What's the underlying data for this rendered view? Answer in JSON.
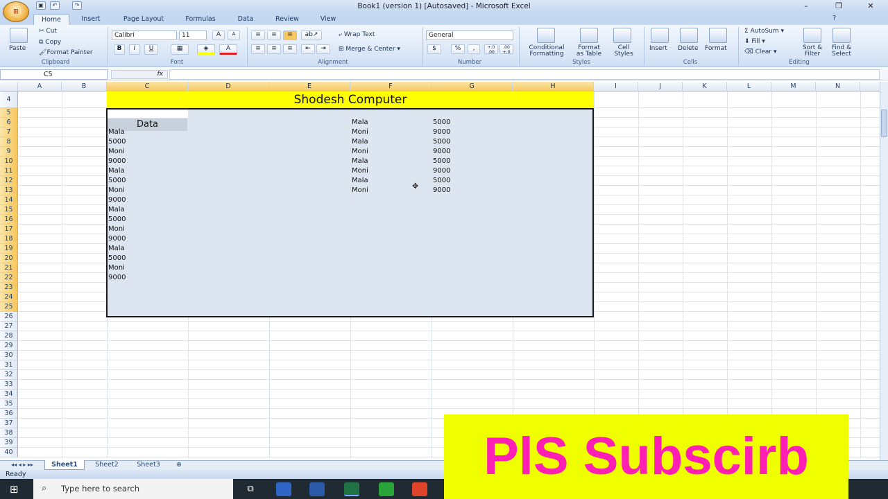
{
  "window": {
    "title": "Book1 (version 1) [Autosaved] - Microsoft Excel"
  },
  "qat": {
    "save_icon": "save-icon",
    "undo_icon": "undo-icon",
    "redo_icon": "redo-icon",
    "office_icon": "office-logo-icon"
  },
  "tabs": [
    {
      "label": "Home"
    },
    {
      "label": "Insert"
    },
    {
      "label": "Page Layout"
    },
    {
      "label": "Formulas"
    },
    {
      "label": "Data"
    },
    {
      "label": "Review"
    },
    {
      "label": "View"
    }
  ],
  "ribbon": {
    "clipboard": {
      "paste": "Paste",
      "cut": "Cut",
      "copy": "Copy",
      "format_painter": "Format Painter",
      "label": "Clipboard"
    },
    "font": {
      "name": "Calibri",
      "size": "11",
      "label": "Font",
      "bold": "B",
      "italic": "I",
      "underline": "U",
      "grow": "A",
      "shrink": "A",
      "font_color": "A"
    },
    "alignment": {
      "wrap": "Wrap Text",
      "merge": "Merge & Center",
      "label": "Alignment"
    },
    "number": {
      "format": "General",
      "currency": "$",
      "percent": "%",
      "comma": ",",
      "inc_dec": "+.0 .00",
      "dec_dec": ".00 +.0",
      "label": "Number"
    },
    "styles": {
      "conditional": [
        "Conditional",
        "Formatting"
      ],
      "format_table": [
        "Format",
        "as Table"
      ],
      "cell_styles": [
        "Cell",
        "Styles"
      ],
      "label": "Styles"
    },
    "cells": {
      "insert": "Insert",
      "delete": "Delete",
      "format": "Format",
      "label": "Cells"
    },
    "editing": {
      "autosum": "AutoSum",
      "fill": "Fill",
      "clear": "Clear",
      "sort": [
        "Sort &",
        "Filter"
      ],
      "find": [
        "Find &",
        "Select"
      ],
      "label": "Editing"
    }
  },
  "formula_bar": {
    "name_box": "C5",
    "fx": "fx",
    "value": ""
  },
  "columns": [
    "A",
    "B",
    "C",
    "D",
    "E",
    "F",
    "G",
    "H",
    "I",
    "J",
    "K",
    "L",
    "M",
    "N"
  ],
  "rows": [
    "4",
    "5",
    "6",
    "7",
    "8",
    "9",
    "10",
    "11",
    "12",
    "13",
    "14",
    "15",
    "16",
    "17",
    "18",
    "19",
    "20",
    "21",
    "22",
    "23",
    "24",
    "25",
    "26",
    "27",
    "28",
    "29",
    "30",
    "31",
    "32",
    "33",
    "34",
    "35",
    "36",
    "37",
    "38",
    "39",
    "40"
  ],
  "sheet": {
    "title_banner": "Shodesh Computer",
    "data_header": "Data",
    "column_c": [
      "Mala",
      "5000",
      "Moni",
      "9000",
      "Mala",
      "5000",
      "Moni",
      "9000",
      "Mala",
      "5000",
      "Moni",
      "9000",
      "Mala",
      "5000",
      "Moni",
      "9000"
    ],
    "column_f": [
      "Mala",
      "Moni",
      "Mala",
      "Moni",
      "Mala",
      "Moni",
      "Mala",
      "Moni"
    ],
    "column_g": [
      "5000",
      "9000",
      "5000",
      "9000",
      "5000",
      "9000",
      "5000",
      "9000"
    ]
  },
  "sheet_tabs": [
    {
      "label": "Sheet1"
    },
    {
      "label": "Sheet2"
    },
    {
      "label": "Sheet3"
    }
  ],
  "status": {
    "text": "Ready"
  },
  "taskbar": {
    "search_placeholder": "Type here to search"
  },
  "overlay": {
    "text": "PlS Subscirb"
  },
  "colors": {
    "banner": "#ffff00",
    "overlay_bg": "#f0ff00",
    "overlay_text": "#ff1fb3",
    "selection_fill": "#dde5f0"
  }
}
